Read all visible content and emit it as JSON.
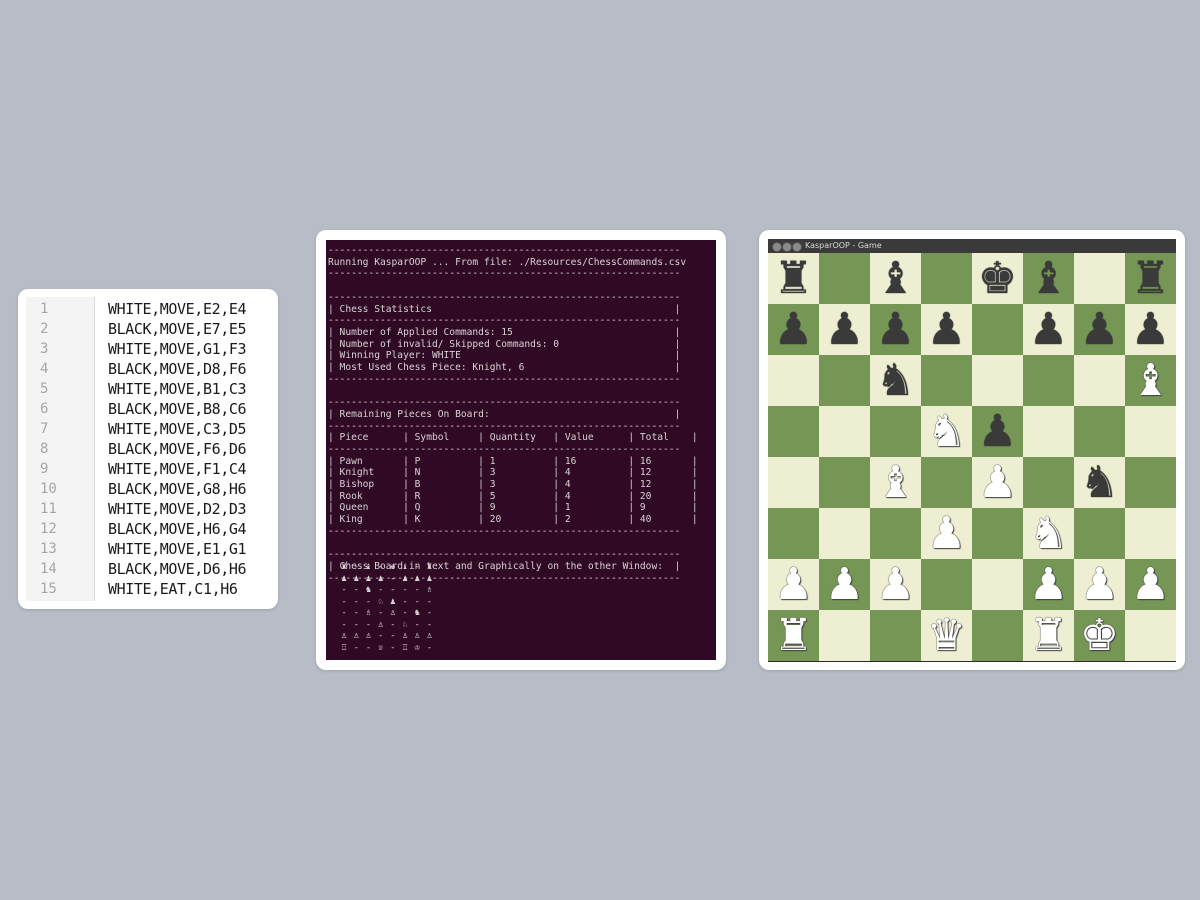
{
  "csv_editor": {
    "lines": [
      {
        "num": "1",
        "text": "WHITE,MOVE,E2,E4"
      },
      {
        "num": "2",
        "text": "BLACK,MOVE,E7,E5"
      },
      {
        "num": "3",
        "text": "WHITE,MOVE,G1,F3"
      },
      {
        "num": "4",
        "text": "BLACK,MOVE,D8,F6"
      },
      {
        "num": "5",
        "text": "WHITE,MOVE,B1,C3"
      },
      {
        "num": "6",
        "text": "BLACK,MOVE,B8,C6"
      },
      {
        "num": "7",
        "text": "WHITE,MOVE,C3,D5"
      },
      {
        "num": "8",
        "text": "BLACK,MOVE,F6,D6"
      },
      {
        "num": "9",
        "text": "WHITE,MOVE,F1,C4"
      },
      {
        "num": "10",
        "text": "BLACK,MOVE,G8,H6"
      },
      {
        "num": "11",
        "text": "WHITE,MOVE,D2,D3"
      },
      {
        "num": "12",
        "text": "BLACK,MOVE,H6,G4"
      },
      {
        "num": "13",
        "text": "WHITE,MOVE,E1,G1"
      },
      {
        "num": "14",
        "text": "BLACK,MOVE,D6,H6"
      },
      {
        "num": "15",
        "text": "WHITE,EAT,C1,H6"
      }
    ]
  },
  "terminal": {
    "lines": [
      "-------------------------------------------------------------",
      "Running KasparOOP ... From file: ./Resources/ChessCommands.csv",
      "-------------------------------------------------------------",
      "",
      "-------------------------------------------------------------",
      "| Chess Statistics                                          |",
      "-------------------------------------------------------------",
      "| Number of Applied Commands: 15                            |",
      "| Number of invalid/ Skipped Commands: 0                    |",
      "| Winning Player: WHITE                                     |",
      "| Most Used Chess Piece: Knight, 6                          |",
      "-------------------------------------------------------------",
      "",
      "-------------------------------------------------------------",
      "| Remaining Pieces On Board:                                |",
      "-------------------------------------------------------------",
      "| Piece      | Symbol     | Quantity   | Value      | Total    |",
      "-------------------------------------------------------------",
      "| Pawn       | P          | 1          | 16         | 16       |",
      "| Knight     | N          | 3          | 4          | 12       |",
      "| Bishop     | B          | 3          | 4          | 12       |",
      "| Rook       | R          | 5          | 4          | 20       |",
      "| Queen      | Q          | 9          | 1          | 9        |",
      "| King       | K          | 20         | 2          | 40       |",
      "-------------------------------------------------------------",
      "",
      "-------------------------------------------------------------",
      "| Chess Board in text and Graphically on the other Window:  |",
      "-------------------------------------------------------------"
    ],
    "board_rows": [
      [
        "♜",
        "-",
        "♝",
        "-",
        "♚",
        "♝",
        "-",
        "♜"
      ],
      [
        "♟",
        "♟",
        "♟",
        "♟",
        "-",
        "♟",
        "♟",
        "♟"
      ],
      [
        "-",
        "-",
        "♞",
        "-",
        "-",
        "-",
        "-",
        "♗"
      ],
      [
        "-",
        "-",
        "-",
        "♘",
        "♟",
        "-",
        "-",
        "-"
      ],
      [
        "-",
        "-",
        "♗",
        "-",
        "♙",
        "-",
        "♞",
        "-"
      ],
      [
        "-",
        "-",
        "-",
        "♙",
        "-",
        "♘",
        "-",
        "-"
      ],
      [
        "♙",
        "♙",
        "♙",
        "-",
        "-",
        "♙",
        "♙",
        "♙"
      ],
      [
        "♖",
        "-",
        "-",
        "♕",
        "-",
        "♖",
        "♔",
        "-"
      ]
    ]
  },
  "game_window": {
    "title": "KasparOOP - Game",
    "board": [
      [
        "r",
        "",
        "b",
        "",
        "k",
        "b",
        "",
        "r"
      ],
      [
        "p",
        "p",
        "p",
        "p",
        "",
        "p",
        "p",
        "p"
      ],
      [
        "",
        "",
        "n",
        "",
        "",
        "",
        "",
        "B"
      ],
      [
        "",
        "",
        "",
        "N",
        "p",
        "",
        "",
        ""
      ],
      [
        "",
        "",
        "B",
        "",
        "P",
        "",
        "n",
        ""
      ],
      [
        "",
        "",
        "",
        "P",
        "",
        "N",
        "",
        ""
      ],
      [
        "P",
        "P",
        "P",
        "",
        "",
        "P",
        "P",
        "P"
      ],
      [
        "R",
        "",
        "",
        "Q",
        "",
        "R",
        "K",
        ""
      ]
    ]
  },
  "icons": {
    "window_buttons": [
      "close-icon",
      "minimize-icon",
      "maximize-icon"
    ]
  }
}
